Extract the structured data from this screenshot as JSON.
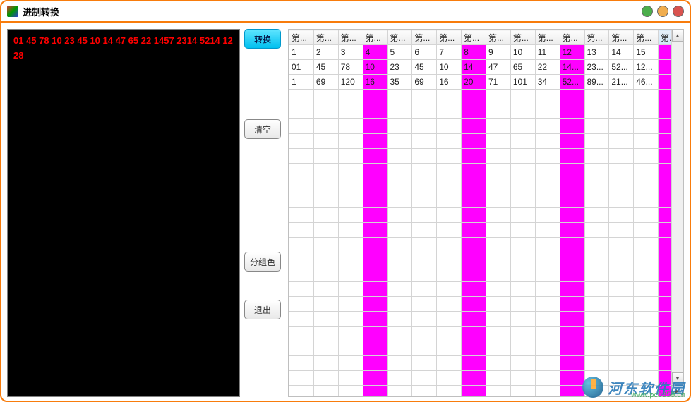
{
  "window": {
    "title": "进制转换"
  },
  "leftText": "01 45 78 10 23 45 10 14 47 65 22 1457 2314 5214 1228",
  "buttons": {
    "convert": "转换",
    "clear": "清空",
    "groupColor": "分组色",
    "exit": "退出"
  },
  "grid": {
    "columnHeaderPrefix": "第...",
    "columnCount": 16,
    "highlightCols": [
      3,
      7,
      11,
      15
    ],
    "sortedCol": 15,
    "rows": [
      [
        "1",
        "2",
        "3",
        "4",
        "5",
        "6",
        "7",
        "8",
        "9",
        "10",
        "11",
        "12",
        "13",
        "14",
        "15",
        ""
      ],
      [
        "01",
        "45",
        "78",
        "10",
        "23",
        "45",
        "10",
        "14",
        "47",
        "65",
        "22",
        "14...",
        "23...",
        "52...",
        "12...",
        ""
      ],
      [
        "1",
        "69",
        "120",
        "16",
        "35",
        "69",
        "16",
        "20",
        "71",
        "101",
        "34",
        "52...",
        "89...",
        "21...",
        "46...",
        ""
      ]
    ],
    "emptyRowCount": 21
  },
  "watermark": {
    "text": "河东软件园",
    "url": "www.pc0359.cn"
  }
}
